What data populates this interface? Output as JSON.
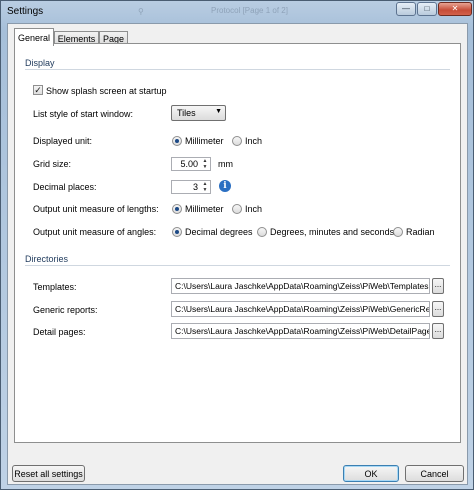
{
  "window": {
    "title": "Settings",
    "background_text": "Protocol [Page 1 of 2]"
  },
  "tabs": [
    {
      "label": "General",
      "active": true
    },
    {
      "label": "Elements",
      "active": false
    },
    {
      "label": "Page",
      "active": false
    }
  ],
  "display": {
    "heading": "Display",
    "splash_label": "Show splash screen at startup",
    "splash_checked": true,
    "list_style_label": "List style of start window:",
    "list_style_value": "Tiles",
    "unit_label": "Displayed unit:",
    "unit_options": [
      "Millimeter",
      "Inch"
    ],
    "unit_selected": "Millimeter",
    "grid_label": "Grid size:",
    "grid_value": "5.00",
    "grid_unit": "mm",
    "decimal_label": "Decimal places:",
    "decimal_value": "3",
    "lengths_label": "Output unit measure of lengths:",
    "lengths_options": [
      "Millimeter",
      "Inch"
    ],
    "lengths_selected": "Millimeter",
    "angles_label": "Output unit measure of angles:",
    "angles_options": [
      "Decimal degrees",
      "Degrees, minutes and seconds",
      "Radian"
    ],
    "angles_selected": "Decimal degrees"
  },
  "directories": {
    "heading": "Directories",
    "templates_label": "Templates:",
    "templates_value": "C:\\Users\\Laura Jaschke\\AppData\\Roaming\\Zeiss\\PiWeb\\Templates",
    "generic_label": "Generic reports:",
    "generic_value": "C:\\Users\\Laura Jaschke\\AppData\\Roaming\\Zeiss\\PiWeb\\GenericReports",
    "detail_label": "Detail pages:",
    "detail_value": "C:\\Users\\Laura Jaschke\\AppData\\Roaming\\Zeiss\\PiWeb\\DetailPages",
    "browse_label": "..."
  },
  "footer": {
    "reset_label": "Reset all settings",
    "ok_label": "OK",
    "cancel_label": "Cancel"
  },
  "colors": {
    "section_heading": "#1e395b",
    "close_button": "#c74c36",
    "radio_dot": "#1d4a86",
    "info_icon": "#2b6fc2"
  },
  "icons": {
    "close": "close-icon",
    "minimize": "minimize-icon",
    "maximize": "maximize-icon",
    "info": "info-icon",
    "dropdown": "chevron-down-icon",
    "spin": "spin-arrows-icon"
  }
}
